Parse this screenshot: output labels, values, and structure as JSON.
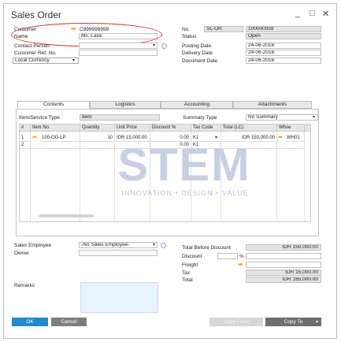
{
  "window": {
    "title": "Sales Order",
    "minimize": "_",
    "maximize": "□",
    "close": "✕"
  },
  "header_left": {
    "customer_label": "Customer",
    "customer_value": "C999999999",
    "name_label": "Name",
    "name_value": "Ms. Laila",
    "contact_label": "Contact Person",
    "contact_value": "",
    "ref_label": "Customer Ref. No.",
    "ref_value": "",
    "currency_value": "Local Currency"
  },
  "header_right": {
    "no_label": "No.",
    "series_value": "SL-OR",
    "no_value": "100000059",
    "status_label": "Status",
    "status_value": "Open",
    "posting_label": "Posting Date",
    "posting_value": "24-06-2016",
    "delivery_label": "Delivery Date",
    "delivery_value": "24-06-2016",
    "document_label": "Document Date",
    "document_value": "24-06-2016"
  },
  "tabs": [
    "Contents",
    "Logistics",
    "Accounting",
    "Attachments"
  ],
  "contents": {
    "type_label": "Item/Service Type",
    "type_value": "Item",
    "summary_label": "Summary Type",
    "summary_value": "No Summary"
  },
  "table": {
    "headers": [
      "#",
      "Item No.",
      "Quantity",
      "Unit Price",
      "Discount %",
      "Tax Code",
      "Total (LC)",
      "Whse",
      ":"
    ],
    "rows": [
      [
        "1",
        "100-OG-LP",
        "10",
        "IDR 15,000.00",
        "0.00",
        "K1",
        "IDR 150,000.00",
        "WH01",
        ""
      ],
      [
        "2",
        "",
        "",
        "",
        "0.00",
        "K1",
        "",
        "",
        ""
      ]
    ]
  },
  "watermark": {
    "main": "STEM",
    "sub": "INNOVATION • DESIGN • VALUE"
  },
  "footer_left": {
    "employee_label": "Sales Employee",
    "employee_value": "-No Sales Employee-",
    "owner_label": "Owner",
    "owner_value": "",
    "remarks_label": "Remarks",
    "remarks_value": ""
  },
  "totals": {
    "before_label": "Total Before Discount",
    "before_value": "IDR 150,000.00",
    "discount_label": "Discount",
    "discount_value": "",
    "percent": "%",
    "freight_label": "Freight",
    "freight_value": "",
    "tax_label": "Tax",
    "tax_value": "IDR 15,000.00",
    "total_label": "Total",
    "total_value": "IDR 165,000.00"
  },
  "buttons": {
    "ok": "OK",
    "cancel": "Cancel",
    "copy_from": "Copy From",
    "copy_to": "Copy To"
  },
  "colors": {
    "ok_bg": "#1f8ad0",
    "cancel_bg": "#7d7d7d",
    "copy_to_bg": "#6e6e6e",
    "copy_from_bg": "#d6d6d6",
    "ring": "#d9322b",
    "arrow": "#e69a12"
  }
}
